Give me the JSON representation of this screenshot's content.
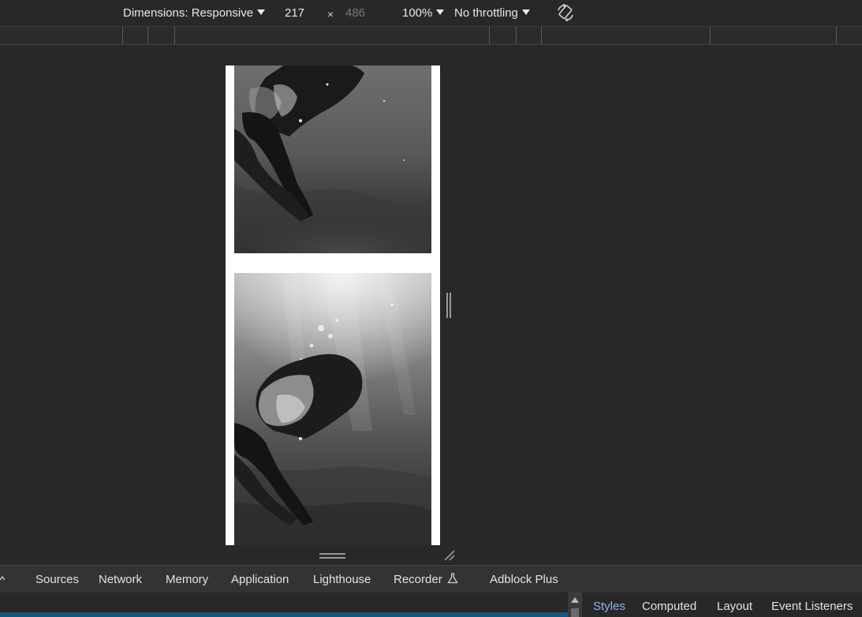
{
  "device_toolbar": {
    "dimensions_label": "Dimensions: Responsive",
    "width_value": "217",
    "times": "×",
    "height_value": "486",
    "zoom": "100%",
    "throttling": "No throttling",
    "rotate_icon": "rotate-icon"
  },
  "devtools_tabs": [
    {
      "label": "Sources"
    },
    {
      "label": "Network"
    },
    {
      "label": "Memory"
    },
    {
      "label": "Application"
    },
    {
      "label": "Lighthouse"
    },
    {
      "label": "Recorder",
      "icon": "flask-icon"
    },
    {
      "label": "Adblock Plus"
    }
  ],
  "styles_tabs": [
    {
      "label": "Styles",
      "active": true
    },
    {
      "label": "Computed"
    },
    {
      "label": "Layout"
    },
    {
      "label": "Event Listeners"
    }
  ],
  "colors": {
    "background": "#282828",
    "tab_bar": "#333333",
    "active_tab": "#8ab4f8",
    "progress": "#0e5a85"
  }
}
